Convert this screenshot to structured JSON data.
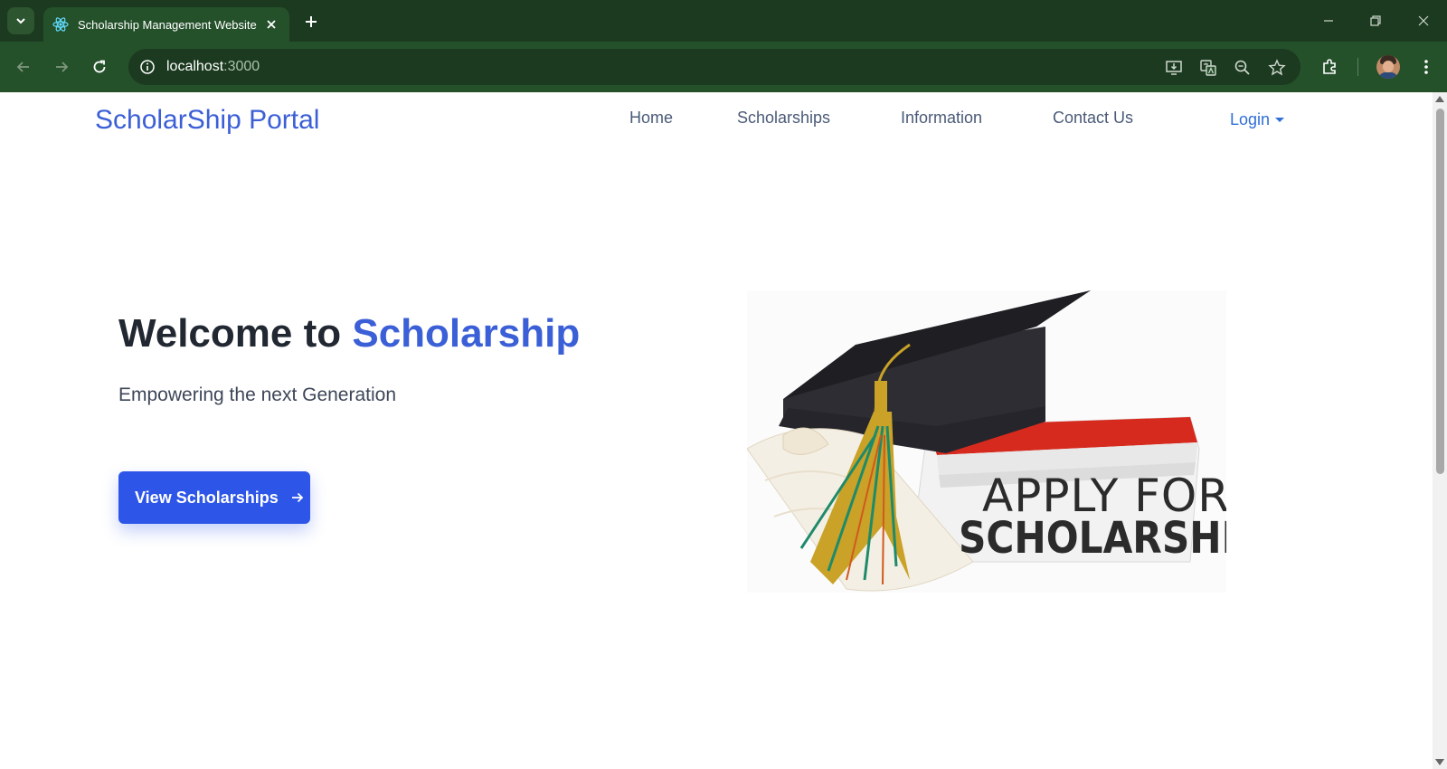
{
  "browser": {
    "tab_title": "Scholarship Management Website",
    "url_host": "localhost",
    "url_port": ":3000",
    "icons": [
      "tab-search-icon",
      "react-icon",
      "close-icon",
      "plus-icon",
      "minimize-icon",
      "restore-icon",
      "close-window-icon",
      "back-icon",
      "forward-icon",
      "reload-icon",
      "site-info-icon",
      "install-app-icon",
      "translate-icon",
      "zoom-icon",
      "bookmark-star-icon",
      "extensions-icon",
      "more-menu-icon"
    ]
  },
  "nav": {
    "brand": "ScholarShip Portal",
    "links": [
      "Home",
      "Scholarships",
      "Information",
      "Contact Us"
    ],
    "login": "Login"
  },
  "hero": {
    "title_prefix": "Welcome to ",
    "title_accent": "Scholarship",
    "subtitle": "Empowering the next Generation",
    "cta_label": "View Scholarships"
  },
  "image": {
    "line1": "APPLY FOR",
    "line2": "SCHOLARSHIPS"
  },
  "colors": {
    "brand_blue": "#3b5fd6",
    "button_blue": "#2d55e8",
    "chrome_dark": "#1b3a1f",
    "chrome_mid": "#24502a"
  }
}
